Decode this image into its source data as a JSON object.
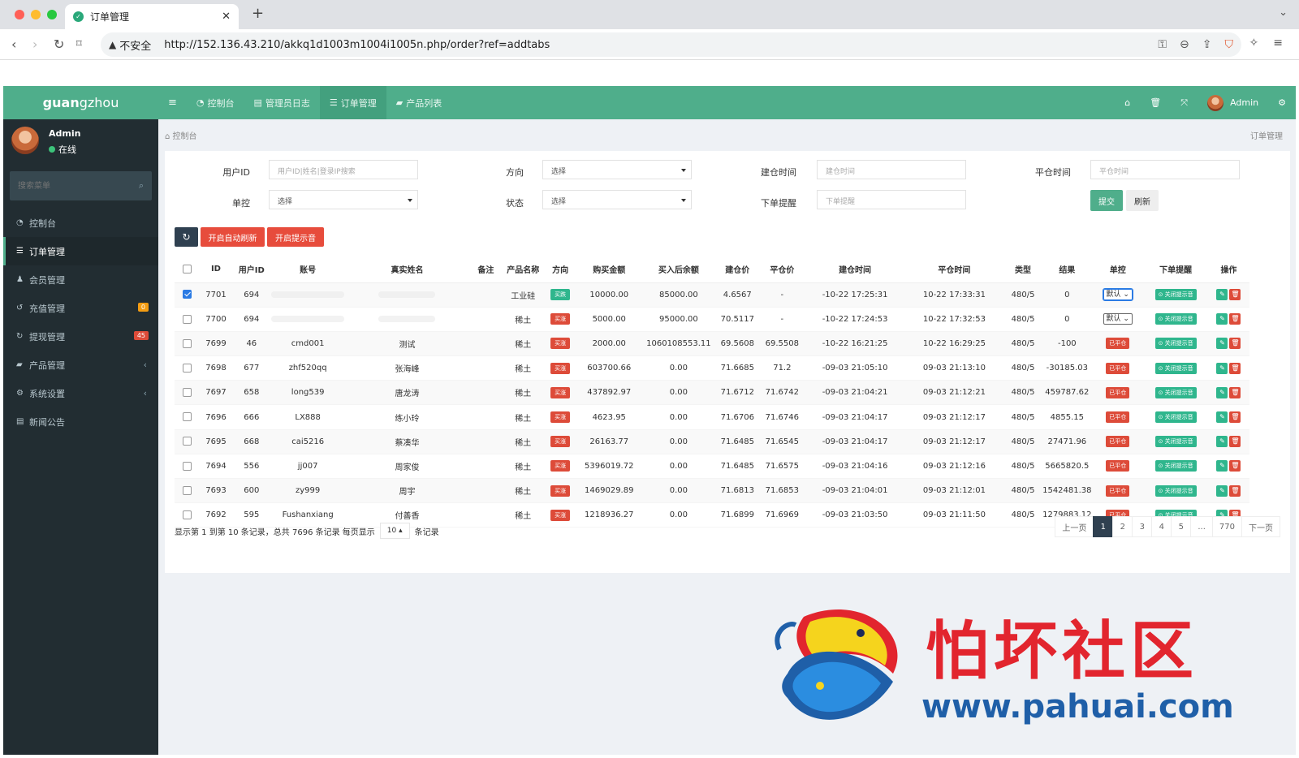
{
  "browser": {
    "tab_title": "订单管理",
    "insecure_label": "不安全",
    "url": "http://152.136.43.210/akkq1d1003m1004i1005n.php/order?ref=addtabs"
  },
  "app": {
    "logo_bold": "guan",
    "logo_rest": "gzhou",
    "user_name": "Admin",
    "user_status": "在线",
    "search_placeholder": "搜索菜单",
    "menu": [
      {
        "label": "控制台",
        "icon": "dashboard-icon"
      },
      {
        "label": "订单管理",
        "icon": "list-icon",
        "active": true
      },
      {
        "label": "会员管理",
        "icon": "users-icon"
      },
      {
        "label": "充值管理",
        "icon": "recharge-icon",
        "badge": "0",
        "badge_color": "#f39c12"
      },
      {
        "label": "提现管理",
        "icon": "withdraw-icon",
        "badge": "45",
        "badge_color": "#dd4b39"
      },
      {
        "label": "产品管理",
        "icon": "bag-icon",
        "caret": "‹"
      },
      {
        "label": "系统设置",
        "icon": "cogs-icon",
        "caret": "‹"
      },
      {
        "label": "新闻公告",
        "icon": "news-icon"
      }
    ],
    "topnav": [
      {
        "label": "控制台"
      },
      {
        "label": "管理员日志"
      },
      {
        "label": "订单管理",
        "active": true
      },
      {
        "label": "产品列表"
      }
    ],
    "top_user": "Admin",
    "breadcrumb": "控制台",
    "breadcrumb_right": "订单管理"
  },
  "filters": {
    "user_id_label": "用户ID",
    "user_id_placeholder": "用户ID|姓名|登录IP搜索",
    "direction_label": "方向",
    "direction_value": "选择",
    "open_time_label": "建仓时间",
    "open_time_placeholder": "建仓时间",
    "close_time_label": "平仓时间",
    "close_time_placeholder": "平仓时间",
    "control_label": "单控",
    "control_value": "选择",
    "status_label": "状态",
    "status_value": "选择",
    "remind_label": "下单提醒",
    "remind_placeholder": "下单提醒",
    "submit": "提交",
    "reset": "刷新"
  },
  "toolbar": {
    "auto_refresh": "开启自动刷新",
    "sound": "开启提示音"
  },
  "table": {
    "headers": [
      "ID",
      "用户ID",
      "账号",
      "真实姓名",
      "备注",
      "产品名称",
      "方向",
      "购买金额",
      "买入后余额",
      "建仓价",
      "平仓价",
      "建仓时间",
      "平仓时间",
      "类型",
      "结果",
      "单控",
      "下单提醒",
      "操作"
    ],
    "rows": [
      {
        "checked": true,
        "id": "7701",
        "uid": "694",
        "account": "",
        "name": "",
        "note": "",
        "product": "工业硅",
        "dir": "买跌",
        "dir_color": "#2fb68d",
        "amount": "10000.00",
        "balance": "85000.00",
        "open": "4.6567",
        "close": "-",
        "open_time": "-10-22 17:25:31",
        "close_time": "10-22 17:33:31",
        "type": "480/5",
        "result": "0",
        "control": "默认",
        "control_focus": true,
        "remind": "关闭提示音"
      },
      {
        "checked": false,
        "id": "7700",
        "uid": "694",
        "account": "",
        "name": "",
        "note": "",
        "product": "稀土",
        "dir": "买涨",
        "dir_color": "#dd4b39",
        "amount": "5000.00",
        "balance": "95000.00",
        "open": "70.5117",
        "close": "-",
        "open_time": "-10-22 17:24:53",
        "close_time": "10-22 17:32:53",
        "type": "480/5",
        "result": "0",
        "control": "默认",
        "remind": "关闭提示音"
      },
      {
        "checked": false,
        "id": "7699",
        "uid": "46",
        "account": "cmd001",
        "name": "测试",
        "note": "",
        "product": "稀土",
        "dir": "买涨",
        "dir_color": "#dd4b39",
        "amount": "2000.00",
        "balance": "1060108553.11",
        "open": "69.5608",
        "close": "69.5508",
        "open_time": "-10-22 16:21:25",
        "close_time": "10-22 16:29:25",
        "type": "480/5",
        "result": "-100",
        "status": "已平仓",
        "remind": "关闭提示音"
      },
      {
        "checked": false,
        "id": "7698",
        "uid": "677",
        "account": "zhf520qq",
        "name": "张海峰",
        "note": "",
        "product": "稀土",
        "dir": "买涨",
        "dir_color": "#dd4b39",
        "amount": "603700.66",
        "balance": "0.00",
        "open": "71.6685",
        "close": "71.2",
        "open_time": "-09-03 21:05:10",
        "close_time": "09-03 21:13:10",
        "type": "480/5",
        "result": "-30185.03",
        "status": "已平仓",
        "remind": "关闭提示音"
      },
      {
        "checked": false,
        "id": "7697",
        "uid": "658",
        "account": "long539",
        "name": "唐龙涛",
        "note": "",
        "product": "稀土",
        "dir": "买涨",
        "dir_color": "#dd4b39",
        "amount": "437892.97",
        "balance": "0.00",
        "open": "71.6712",
        "close": "71.6742",
        "open_time": "-09-03 21:04:21",
        "close_time": "09-03 21:12:21",
        "type": "480/5",
        "result": "459787.62",
        "status": "已平仓",
        "remind": "关闭提示音"
      },
      {
        "checked": false,
        "id": "7696",
        "uid": "666",
        "account": "LX888",
        "name": "练小玲",
        "note": "",
        "product": "稀土",
        "dir": "买涨",
        "dir_color": "#dd4b39",
        "amount": "4623.95",
        "balance": "0.00",
        "open": "71.6706",
        "close": "71.6746",
        "open_time": "-09-03 21:04:17",
        "close_time": "09-03 21:12:17",
        "type": "480/5",
        "result": "4855.15",
        "status": "已平仓",
        "remind": "关闭提示音"
      },
      {
        "checked": false,
        "id": "7695",
        "uid": "668",
        "account": "cai5216",
        "name": "蔡凑华",
        "note": "",
        "product": "稀土",
        "dir": "买涨",
        "dir_color": "#dd4b39",
        "amount": "26163.77",
        "balance": "0.00",
        "open": "71.6485",
        "close": "71.6545",
        "open_time": "-09-03 21:04:17",
        "close_time": "09-03 21:12:17",
        "type": "480/5",
        "result": "27471.96",
        "status": "已平仓",
        "remind": "关闭提示音"
      },
      {
        "checked": false,
        "id": "7694",
        "uid": "556",
        "account": "jj007",
        "name": "周家俊",
        "note": "",
        "product": "稀土",
        "dir": "买涨",
        "dir_color": "#dd4b39",
        "amount": "5396019.72",
        "balance": "0.00",
        "open": "71.6485",
        "close": "71.6575",
        "open_time": "-09-03 21:04:16",
        "close_time": "09-03 21:12:16",
        "type": "480/5",
        "result": "5665820.5",
        "status": "已平仓",
        "remind": "关闭提示音"
      },
      {
        "checked": false,
        "id": "7693",
        "uid": "600",
        "account": "zy999",
        "name": "周宇",
        "note": "",
        "product": "稀土",
        "dir": "买涨",
        "dir_color": "#dd4b39",
        "amount": "1469029.89",
        "balance": "0.00",
        "open": "71.6813",
        "close": "71.6853",
        "open_time": "-09-03 21:04:01",
        "close_time": "09-03 21:12:01",
        "type": "480/5",
        "result": "1542481.38",
        "status": "已平仓",
        "remind": "关闭提示音"
      },
      {
        "checked": false,
        "id": "7692",
        "uid": "595",
        "account": "Fushanxiang",
        "name": "付善香",
        "note": "",
        "product": "稀土",
        "dir": "买涨",
        "dir_color": "#dd4b39",
        "amount": "1218936.27",
        "balance": "0.00",
        "open": "71.6899",
        "close": "71.6969",
        "open_time": "-09-03 21:03:50",
        "close_time": "09-03 21:11:50",
        "type": "480/5",
        "result": "1279883.12",
        "status": "已平仓",
        "remind": "关闭提示音"
      }
    ]
  },
  "pagination": {
    "info_prefix": "显示第 1 到第 10 条记录，总共 7696 条记录 每页显示",
    "page_size": "10",
    "info_suffix": "条记录",
    "prev": "上一页",
    "pages": [
      "1",
      "2",
      "3",
      "4",
      "5",
      "...",
      "770"
    ],
    "next": "下一页"
  },
  "watermark": {
    "title": "怕坏社区",
    "url": "www.pahuai.com"
  }
}
